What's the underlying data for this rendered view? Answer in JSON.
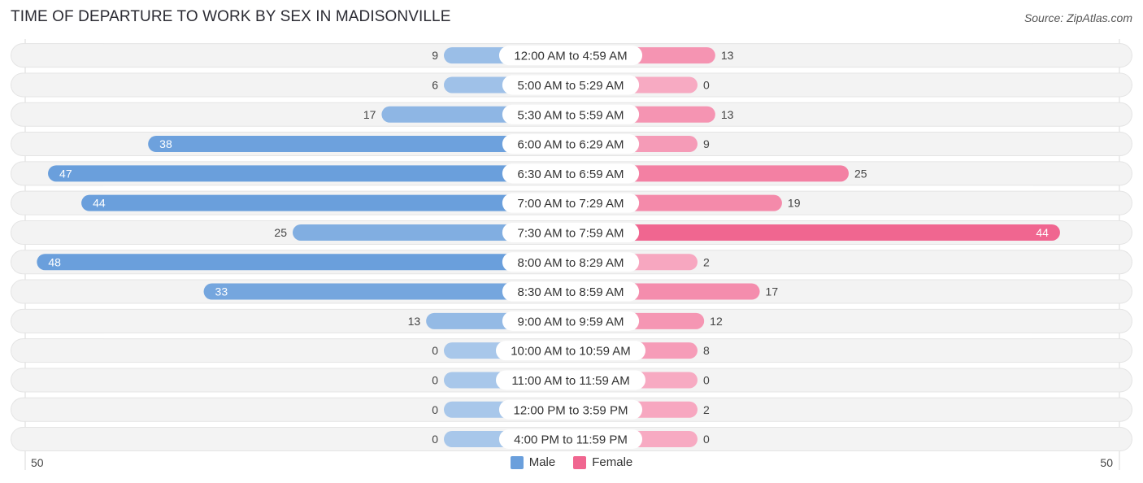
{
  "header": {
    "title": "TIME OF DEPARTURE TO WORK BY SEX IN MADISONVILLE",
    "source": "Source: ZipAtlas.com"
  },
  "colors": {
    "male": "#6a9fdc",
    "male_light": "#a8c7ea",
    "female": "#f06690",
    "female_light": "#f7aac2",
    "row_bg": "#f3f3f3",
    "row_border": "#dddddd"
  },
  "chart_data": {
    "type": "bar",
    "orientation": "horizontal-diverging",
    "title": "TIME OF DEPARTURE TO WORK BY SEX IN MADISONVILLE",
    "categories": [
      "12:00 AM to 4:59 AM",
      "5:00 AM to 5:29 AM",
      "5:30 AM to 5:59 AM",
      "6:00 AM to 6:29 AM",
      "6:30 AM to 6:59 AM",
      "7:00 AM to 7:29 AM",
      "7:30 AM to 7:59 AM",
      "8:00 AM to 8:29 AM",
      "8:30 AM to 8:59 AM",
      "9:00 AM to 9:59 AM",
      "10:00 AM to 10:59 AM",
      "11:00 AM to 11:59 AM",
      "12:00 PM to 3:59 PM",
      "4:00 PM to 11:59 PM"
    ],
    "series": [
      {
        "name": "Male",
        "values": [
          9,
          6,
          17,
          38,
          47,
          44,
          25,
          48,
          33,
          13,
          0,
          0,
          0,
          0
        ]
      },
      {
        "name": "Female",
        "values": [
          13,
          0,
          13,
          9,
          25,
          19,
          44,
          2,
          17,
          12,
          8,
          0,
          2,
          0
        ]
      }
    ],
    "axis": {
      "left_label": "50",
      "right_label": "50",
      "max": 50
    },
    "legend": {
      "position": "bottom-center",
      "entries": [
        "Male",
        "Female"
      ]
    },
    "grid": false
  }
}
